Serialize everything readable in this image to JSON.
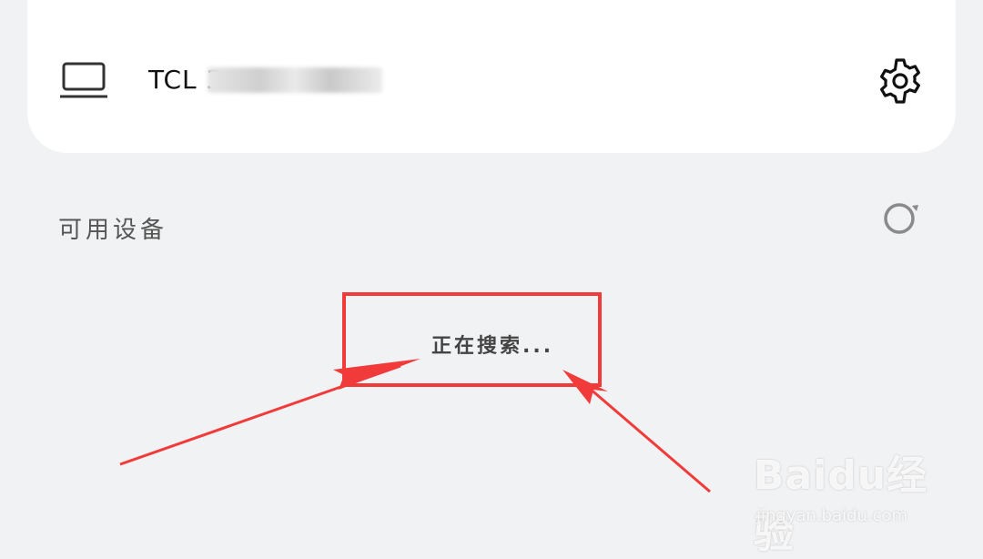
{
  "paired_device": {
    "name": "TCL 3",
    "icon": "laptop-icon",
    "settings_icon": "gear-icon"
  },
  "available": {
    "title": "可用设备",
    "refresh_icon": "refresh-icon",
    "status": "正在搜索..."
  },
  "annotation": {
    "color": "#f13a3a"
  },
  "watermark": {
    "brand": "Baidu经验",
    "url": "jingyan.baidu.com"
  }
}
